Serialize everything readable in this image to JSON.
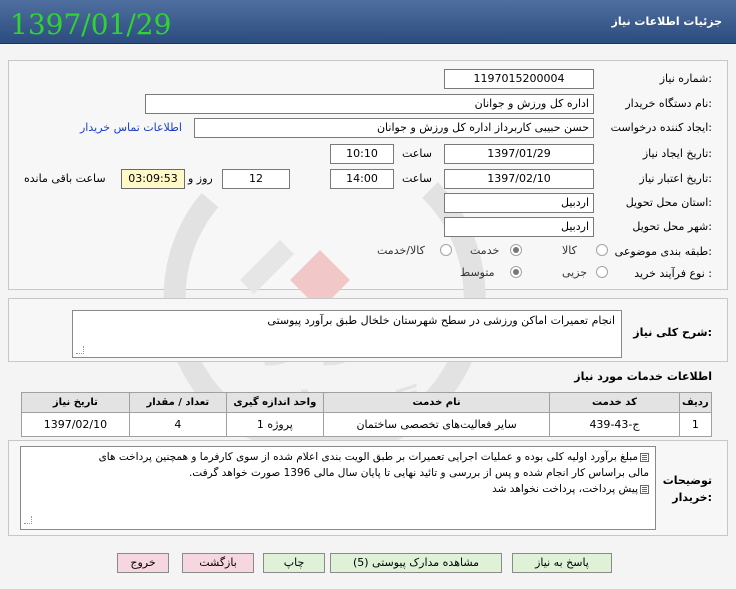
{
  "header": {
    "title": "جزئیات اطلاعات نیاز",
    "date": "1397/01/29"
  },
  "form": {
    "need_number_label": "شماره نیاز:",
    "need_number": "1197015200004",
    "buyer_org_label": "نام دستگاه خریدار:",
    "buyer_org": "اداره کل ورزش و جوانان",
    "requester_label": "ایجاد کننده درخواست:",
    "requester": "حسن حبیبی کاربرداز اداره کل ورزش و جوانان",
    "buyer_contact_link": "اطلاعات تماس خریدار",
    "created_label": "تاریخ ایجاد نیاز:",
    "created_date": "1397/01/29",
    "time_label": "ساعت",
    "created_time": "10:10",
    "valid_label": "تاریخ اعتبار نیاز:",
    "valid_date": "1397/02/10",
    "valid_time": "14:00",
    "days_value": "12",
    "days_label": "روز و",
    "remaining_time": "03:09:53",
    "remaining_label": "ساعت باقی مانده",
    "province_label": "استان محل تحویل:",
    "province": "اردبیل",
    "city_label": "شهر محل تحویل:",
    "city": "اردبیل",
    "category_label": "طبقه بندی موضوعی:",
    "category_options": [
      "کالا",
      "خدمت",
      "کالا/خدمت"
    ],
    "category_selected": "خدمت",
    "process_label": "نوع فرآیند خرید :",
    "process_options": [
      "جزیی",
      "متوسط"
    ],
    "process_selected": "متوسط"
  },
  "summary": {
    "label": "شرح کلی نیاز:",
    "text": "انجام تعمیرات اماکن ورزشی در سطح شهرستان خلخال طبق برآورد پیوستی"
  },
  "services": {
    "title": "اطلاعات خدمات مورد نیاز",
    "columns": [
      "ردیف",
      "کد خدمت",
      "نام خدمت",
      "واحد اندازه گیری",
      "تعداد / مقدار",
      "تاریخ نیاز"
    ],
    "rows": [
      {
        "row": "1",
        "code": "ج-43-439",
        "name": "سایر فعالیت‌های تخصصی ساختمان",
        "unit": "1 پروژه",
        "qty": "4",
        "date": "1397/02/10"
      }
    ]
  },
  "buyer_notes": {
    "label_line1": "توضیحات",
    "label_line2": "خریدار:",
    "line1": "مبلغ برآورد اولیه کلی بوده و عملیات اجرایی تعمیرات بر طبق الویت بندی اعلام شده از سوی کارفرما و همچنین پرداخت های",
    "line2": "مالی براساس کار انجام شده و پس از بررسی و تائید نهایی تا پایان سال مالی 1396 صورت خواهد گرفت.",
    "line3": "پیش پرداخت، پرداخت نخواهد شد"
  },
  "buttons": {
    "reply": "پاسخ به نیاز",
    "attachments": "مشاهده مدارک پیوستی (5)",
    "print": "چاپ",
    "back": "بازگشت",
    "exit": "خروج"
  },
  "colors": {
    "header_bg": "#3b5b8e",
    "date_green": "#2fd52f",
    "remaining_bg": "#fff9c8"
  }
}
